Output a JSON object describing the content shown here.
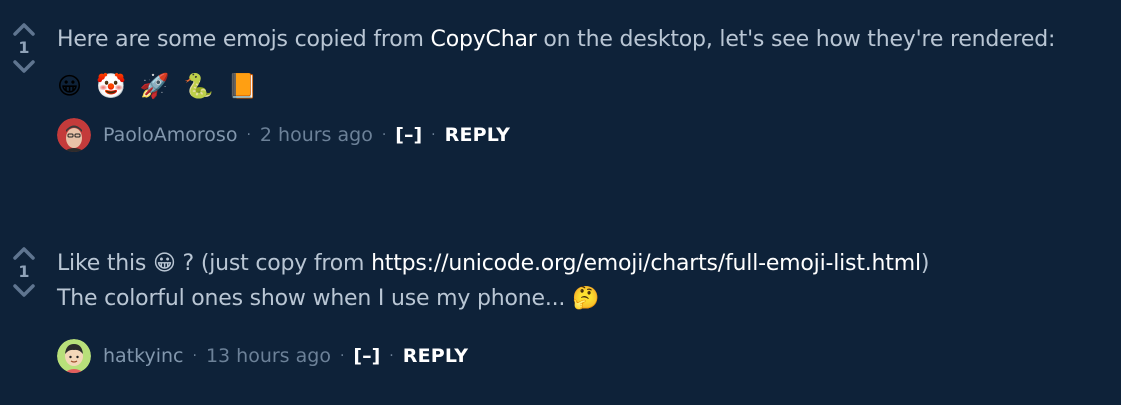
{
  "comments": [
    {
      "score": "1",
      "text_before": "Here are some emojs copied from ",
      "highlight": "CopyChar",
      "text_after": " on the desktop, let's see how they're rendered:",
      "emojis": [
        "😀",
        "🤡",
        "🚀",
        "🐍",
        "📙"
      ],
      "emoji_names": [
        "grinning-face-emoji",
        "clown-face-emoji",
        "rocket-emoji",
        "snake-emoji",
        "orange-book-emoji"
      ],
      "author": "PaoloAmoroso",
      "time": "2 hours ago",
      "toggle": "[–]",
      "reply": "REPLY"
    },
    {
      "score": "1",
      "line1_before": "Like this ",
      "line1_emoji": "😀",
      "line1_mid": " ? (just copy from ",
      "link": "https://unicode.org/emoji/charts/full-emoji-list.html",
      "line1_after": ")",
      "line2": "The colorful ones show when I use my phone... ",
      "line2_emoji": "🤔",
      "author": "hatkyinc",
      "time": "13 hours ago",
      "toggle": "[–]",
      "reply": "REPLY"
    }
  ],
  "separator": "·",
  "icons": {
    "upvote": "upvote-arrow-icon",
    "downvote": "downvote-arrow-icon"
  },
  "colors": {
    "background": "#0e2239",
    "text": "#b9c6d4",
    "emphasis": "#ffffff",
    "muted": "#6c8198"
  }
}
